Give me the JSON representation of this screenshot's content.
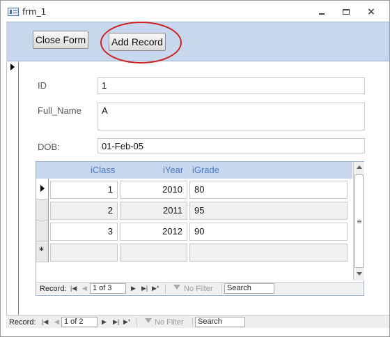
{
  "window": {
    "title": "frm_1",
    "close_glyph": "×"
  },
  "header": {
    "close_form_label": "Close Form",
    "add_record_label": "Add Record",
    "highlight_color": "#d0201c"
  },
  "fields": {
    "id": {
      "label": "ID",
      "value": "1"
    },
    "full_name": {
      "label": "Full_Name",
      "value": "A"
    },
    "dob": {
      "label": "DOB:",
      "value": "01-Feb-05"
    }
  },
  "subform": {
    "columns": [
      "iClass",
      "iYear",
      "iGrade"
    ],
    "rows": [
      {
        "iClass": "1",
        "iYear": "2010",
        "iGrade": "80"
      },
      {
        "iClass": "2",
        "iYear": "2011",
        "iGrade": "95"
      },
      {
        "iClass": "3",
        "iYear": "2012",
        "iGrade": "90"
      }
    ],
    "new_row_marker": "*",
    "nav": {
      "label": "Record:",
      "position": "1 of 3",
      "filter": "No Filter",
      "search": "Search"
    }
  },
  "main_nav": {
    "label": "Record:",
    "position": "1 of 2",
    "filter": "No Filter",
    "search": "Search"
  },
  "icons": {
    "first": "|◀",
    "prev": "◀",
    "next": "▶",
    "last": "▶|",
    "new": "▶*"
  }
}
